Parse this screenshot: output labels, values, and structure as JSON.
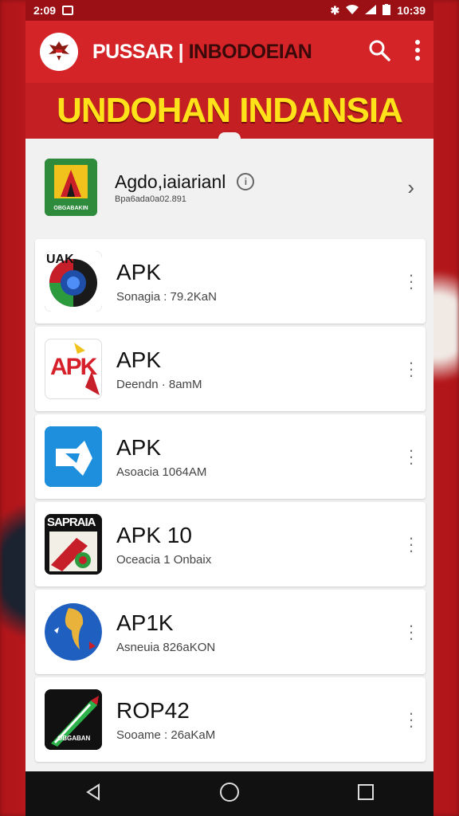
{
  "statusbar": {
    "time_left": "2:09",
    "time_right": "10:39"
  },
  "app": {
    "title_main": "PUSSAR",
    "title_sep": " | ",
    "title_sub": "INBODOEIAN"
  },
  "banner": {
    "text": "UNDOHAN INDANSIA"
  },
  "featured": {
    "icon_label": "OBGABAKIN",
    "title": "Agdo,iaiarianl",
    "subtitle": "Bpa6ada0a02.891"
  },
  "apps": [
    {
      "title": "APK",
      "subtitle": "Sonagia : 79.2KaN",
      "icon_label": "UAK",
      "icon_color": "#1f4ea8"
    },
    {
      "title": "APK",
      "subtitle": "Deendn · 8amM",
      "icon_label": "APK",
      "icon_color": "#d6202a"
    },
    {
      "title": "APK",
      "subtitle": "Asoacia 1064AM",
      "icon_label": "",
      "icon_color": "#1e8fdc"
    },
    {
      "title": "APK 10",
      "subtitle": "Oceacia 1 Onbaix",
      "icon_label": "SAPRAIA",
      "icon_color": "#c71f2a"
    },
    {
      "title": "AP1K",
      "subtitle": "Asneuia 826aKON",
      "icon_label": "",
      "icon_color": "#1e5fbf"
    },
    {
      "title": "ROP42",
      "subtitle": "Sooame : 26aKaM",
      "icon_label": "OBGABAN",
      "icon_color": "#2db14a"
    }
  ],
  "colors": {
    "primary": "#d42428",
    "banner_text": "#ffe21a",
    "statusbar": "#9b1014"
  }
}
